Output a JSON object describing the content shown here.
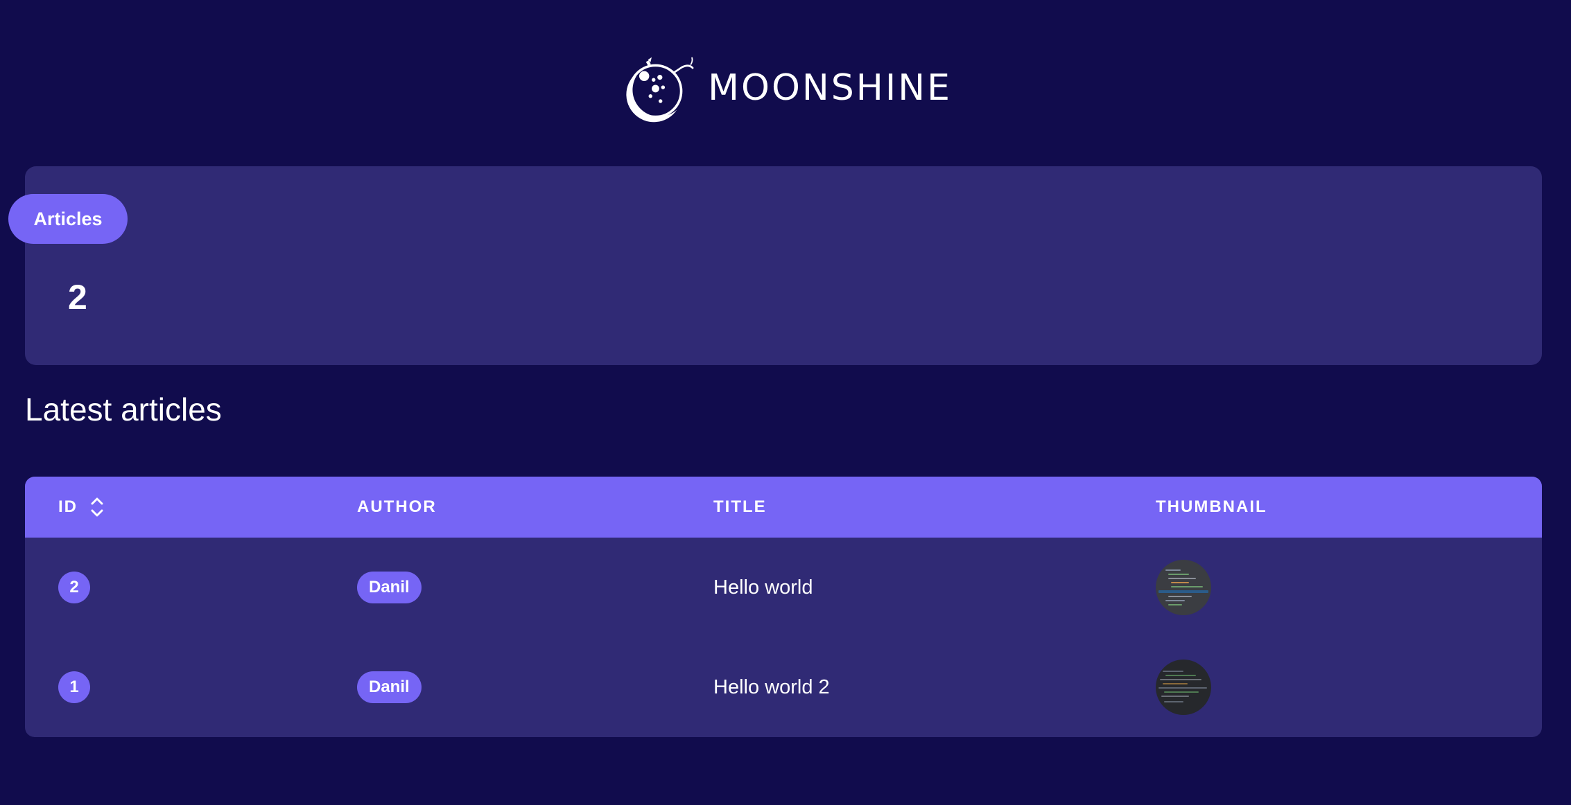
{
  "brand": {
    "name": "MOONSHINE"
  },
  "metric": {
    "label": "Articles",
    "value": "2"
  },
  "section": {
    "title": "Latest articles"
  },
  "table": {
    "headers": {
      "id": "ID",
      "author": "AUTHOR",
      "title": "TITLE",
      "thumbnail": "THUMBNAIL"
    },
    "rows": [
      {
        "id": "2",
        "author": "Danil",
        "title": "Hello world"
      },
      {
        "id": "1",
        "author": "Danil",
        "title": "Hello world 2"
      }
    ]
  },
  "icons": {
    "sort": "sort-icon",
    "logo": "moon-flask-logo-icon"
  },
  "colors": {
    "background": "#110c4d",
    "card": "#302a75",
    "accent": "#7665f5",
    "text": "#ffffff"
  }
}
